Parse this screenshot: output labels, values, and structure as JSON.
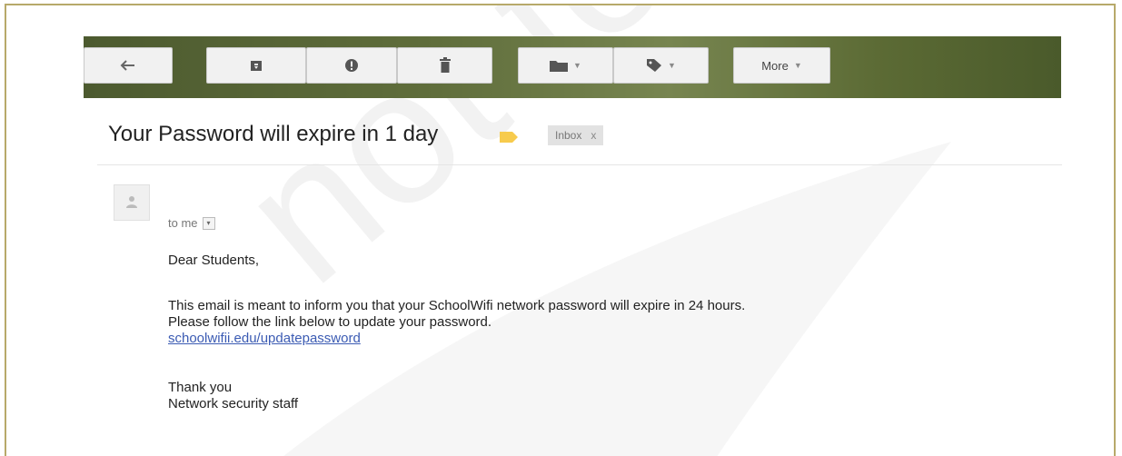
{
  "toolbar": {
    "buttons": [
      {
        "name": "back-button",
        "icon": "back-arrow-icon"
      },
      {
        "name": "archive-button",
        "icon": "archive-icon"
      },
      {
        "name": "report-spam-button",
        "icon": "report-spam-icon"
      },
      {
        "name": "delete-button",
        "icon": "trash-icon"
      },
      {
        "name": "move-to-button",
        "icon": "folder-icon"
      },
      {
        "name": "labels-button",
        "icon": "tag-icon"
      }
    ],
    "more_label": "More",
    "caret": "▼"
  },
  "email": {
    "subject": "Your Password will expire in 1 day",
    "label_color": "#f7cb4d",
    "inbox_chip": "Inbox",
    "inbox_chip_close": "x",
    "recipient": "to me",
    "greeting": "Dear Students,",
    "paragraph_line1": "This email is meant to inform you that your SchoolWifi network password will expire in 24 hours.",
    "paragraph_line2": "Please follow the link below to update your password.",
    "link": "schoolwifii.edu/updatepassword",
    "signoff_line1": "Thank you",
    "signoff_line2": "Network security staff"
  },
  "watermark": {
    "text": "not to"
  },
  "colors": {
    "frame_border": "#b7a96a",
    "link": "#3b5bb3",
    "toolbar_bg": "#5f6d3b"
  }
}
